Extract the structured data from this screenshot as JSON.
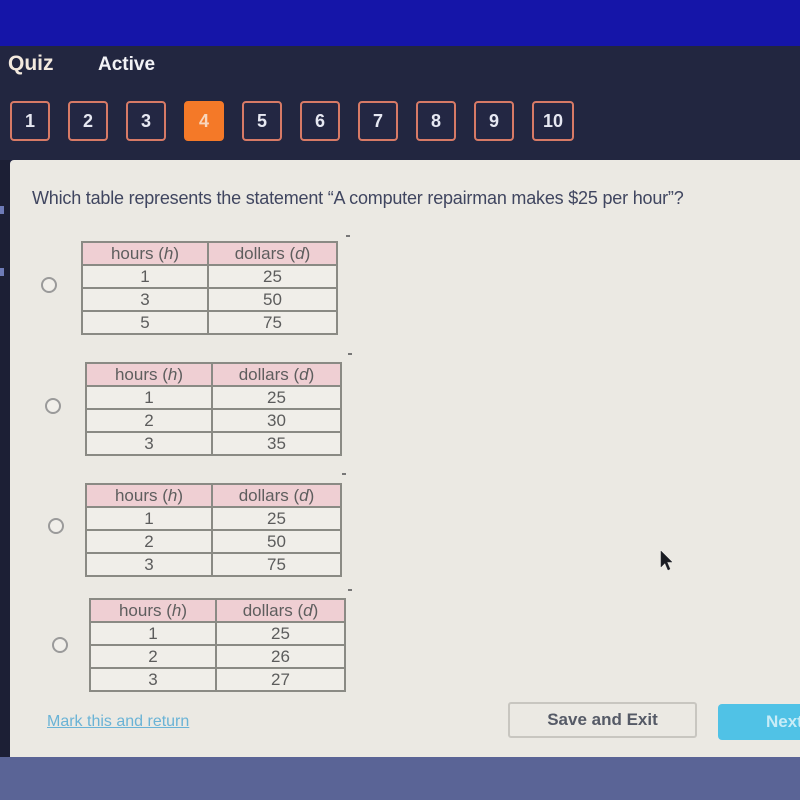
{
  "header": {
    "title": "Quiz",
    "status": "Active",
    "questions": [
      {
        "label": "1",
        "active": false
      },
      {
        "label": "2",
        "active": false
      },
      {
        "label": "3",
        "active": false
      },
      {
        "label": "4",
        "active": true
      },
      {
        "label": "5",
        "active": false
      },
      {
        "label": "6",
        "active": false
      },
      {
        "label": "7",
        "active": false
      },
      {
        "label": "8",
        "active": false
      },
      {
        "label": "9",
        "active": false
      },
      {
        "label": "10",
        "active": false
      }
    ]
  },
  "question": {
    "text": "Which table represents the statement “A computer repairman makes $25 per hour”?"
  },
  "table_headers": {
    "col1_word": "hours (",
    "col1_var": "h",
    "col2_word": "dollars (",
    "col2_var": "d",
    "close": ")"
  },
  "options": [
    {
      "rows": [
        [
          "1",
          "25"
        ],
        [
          "3",
          "50"
        ],
        [
          "5",
          "75"
        ]
      ],
      "selected": false
    },
    {
      "rows": [
        [
          "1",
          "25"
        ],
        [
          "2",
          "30"
        ],
        [
          "3",
          "35"
        ]
      ],
      "selected": false
    },
    {
      "rows": [
        [
          "1",
          "25"
        ],
        [
          "2",
          "50"
        ],
        [
          "3",
          "75"
        ]
      ],
      "selected": false
    },
    {
      "rows": [
        [
          "1",
          "25"
        ],
        [
          "2",
          "26"
        ],
        [
          "3",
          "27"
        ]
      ],
      "selected": false
    }
  ],
  "footer": {
    "mark_link": "Mark this and return",
    "save_button": "Save and Exit",
    "next_button": "Next"
  },
  "colors": {
    "active_question": "#f47928",
    "question_border": "#d77a66",
    "table_header_bg": "#efcfd3",
    "next_button": "#50c2e6",
    "link": "#6ab3d6"
  }
}
